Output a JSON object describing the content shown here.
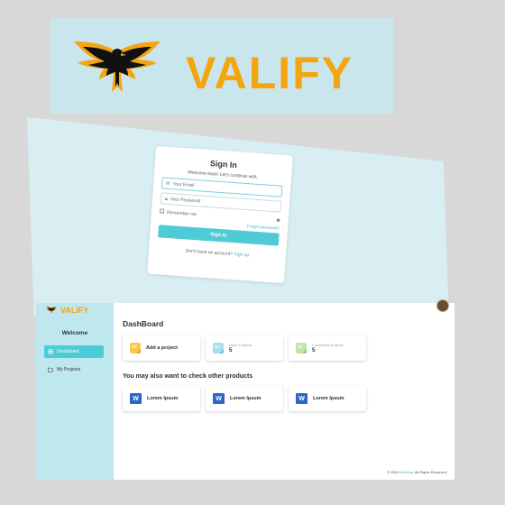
{
  "banner": {
    "brand": "VALIFY",
    "brand_color": "#f5a50f"
  },
  "signin": {
    "title": "Sign In",
    "subtitle": "Welcome back! Let's continue with,",
    "email_placeholder": "Your Email",
    "password_placeholder": "Your Password",
    "remember_label": "Remember me",
    "forgot_label": "Forgot password?",
    "button_label": "Sign In",
    "no_account_text": "Don't have an account?",
    "signup_link": "Sign up"
  },
  "sidebar": {
    "logo_text": "VALIFY",
    "welcome": "Welcome",
    "items": [
      {
        "label": "Dashboard",
        "icon": "grid-icon",
        "active": true
      },
      {
        "label": "My Projects",
        "icon": "folder-icon",
        "active": false
      }
    ]
  },
  "dashboard": {
    "title": "DashBoard",
    "cards": [
      {
        "label": "Add a project",
        "icon": "sticky-note-icon"
      },
      {
        "caption": "Open Projects",
        "value": "5",
        "icon": "note-blue-icon"
      },
      {
        "caption": "Completed Projects",
        "value": "5",
        "icon": "note-green-icon"
      }
    ],
    "other_title": "You may also want to check other products",
    "products": [
      {
        "label": "Lorem Ipsum",
        "icon": "word-icon"
      },
      {
        "label": "Lorem Ipsum",
        "icon": "word-icon"
      },
      {
        "label": "Lorem Ipsum",
        "icon": "word-icon"
      }
    ],
    "footer": {
      "prefix": "© 2024",
      "brand": "Nextbuy",
      "suffix": ". All Rights Reserved."
    }
  },
  "colors": {
    "accent": "#4fcbd8",
    "sidebar_bg": "#bfe8ee",
    "word_blue": "#2b66c9"
  }
}
